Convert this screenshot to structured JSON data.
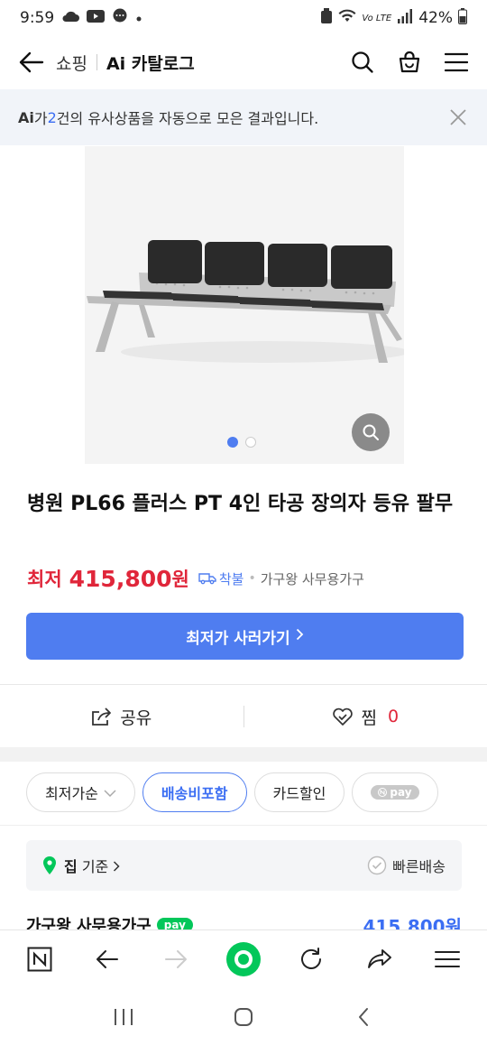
{
  "status_bar": {
    "time": "9:59",
    "battery": "42%",
    "network": "Vo LTE"
  },
  "header": {
    "shop_label": "쇼핑",
    "ai_catalog_label": "Ai 카탈로그"
  },
  "notice": {
    "ai_label": "Ai",
    "text_before": "가 ",
    "count": "2",
    "text_after": "건의 유사상품을 자동으로 모은 결과입니다."
  },
  "product": {
    "title": "병원 PL66 플러스 PT 4인 타공 장의자 등유 팔무",
    "price_label": "최저",
    "price_value": "415,800",
    "price_unit": "원",
    "shipping": "착불",
    "seller": "가구왕 사무용가구",
    "image_page": 1,
    "image_total": 2
  },
  "buy_button": {
    "label": "최저가 사러가기"
  },
  "actions": {
    "share_label": "공유",
    "like_label": "찜",
    "like_count": "0"
  },
  "filters": [
    {
      "label": "최저가순",
      "selected": false
    },
    {
      "label": "배송비포함",
      "selected": true
    },
    {
      "label": "카드할인",
      "selected": false
    },
    {
      "label": "pay",
      "selected": false
    }
  ],
  "location": {
    "place": "집",
    "suffix": "기준",
    "fast_shipping": "빠른배송"
  },
  "first_offer": {
    "seller": "가구왕 사무용가구",
    "badge": "pay",
    "price": "415,800원"
  },
  "colors": {
    "accent": "#4f7df0",
    "price": "#e0263a",
    "npay": "#03c75a"
  }
}
